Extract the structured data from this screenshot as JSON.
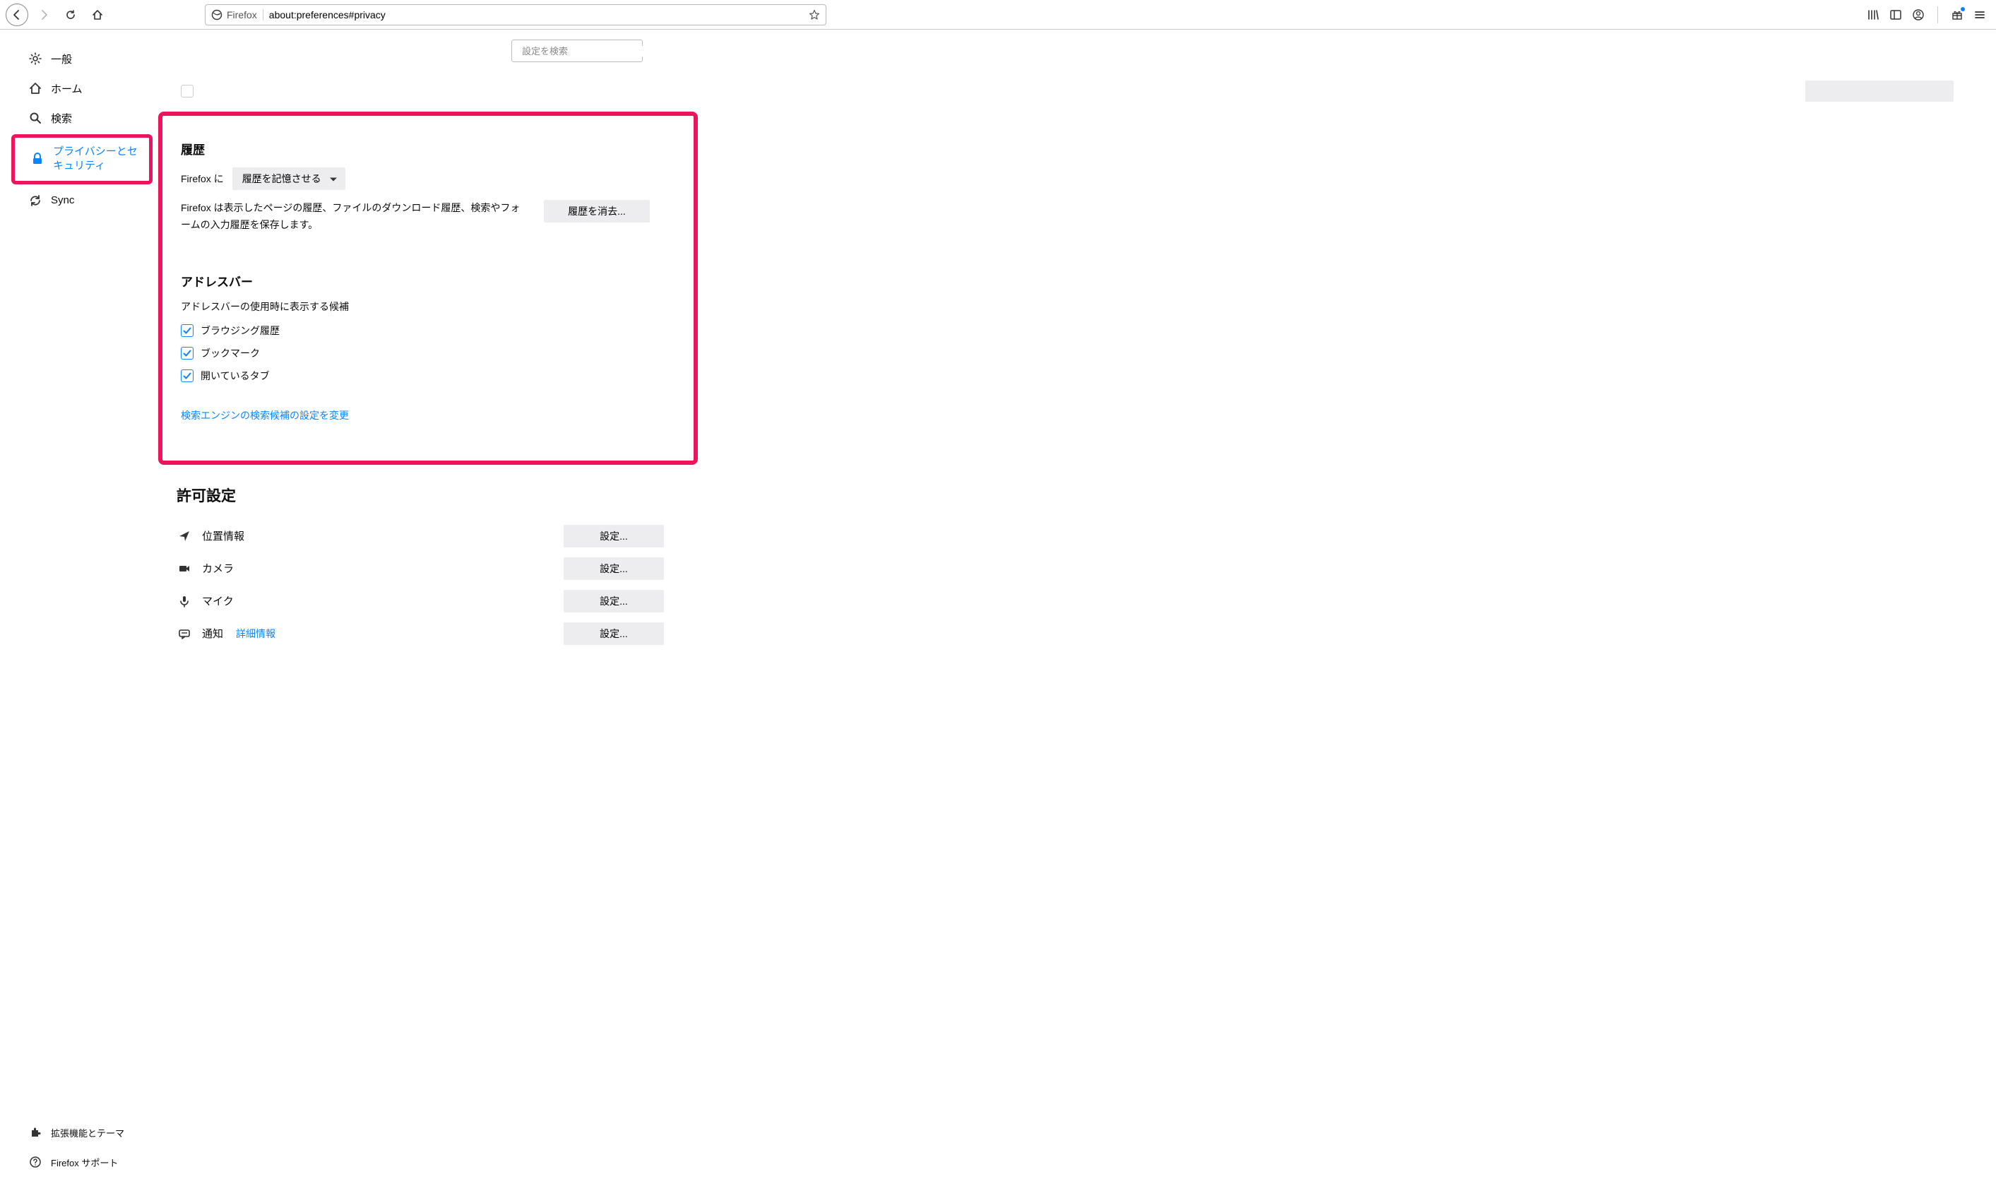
{
  "toolbar": {
    "identity_label": "Firefox",
    "url": "about:preferences#privacy"
  },
  "search": {
    "placeholder": "設定を検索"
  },
  "sidebar": {
    "general": "一般",
    "home": "ホーム",
    "search": "検索",
    "privacy": "プライバシーとセキュリティ",
    "sync": "Sync",
    "extensions": "拡張機能とテーマ",
    "support": "Firefox サポート"
  },
  "history": {
    "title": "履歴",
    "firefox_will_prefix": "Firefox に",
    "select_value": "履歴を記憶させる",
    "description": "Firefox は表示したページの履歴、ファイルのダウンロード履歴、検索やフォームの入力履歴を保存します。",
    "clear_button": "履歴を消去..."
  },
  "addressbar": {
    "title": "アドレスバー",
    "description": "アドレスバーの使用時に表示する候補",
    "opt_browsing": "ブラウジング履歴",
    "opt_bookmarks": "ブックマーク",
    "opt_opentabs": "開いているタブ",
    "link": "検索エンジンの検索候補の設定を変更"
  },
  "permissions": {
    "title": "許可設定",
    "location": "位置情報",
    "camera": "カメラ",
    "microphone": "マイク",
    "notifications": "通知",
    "details_link": "詳細情報",
    "settings_button": "設定..."
  }
}
